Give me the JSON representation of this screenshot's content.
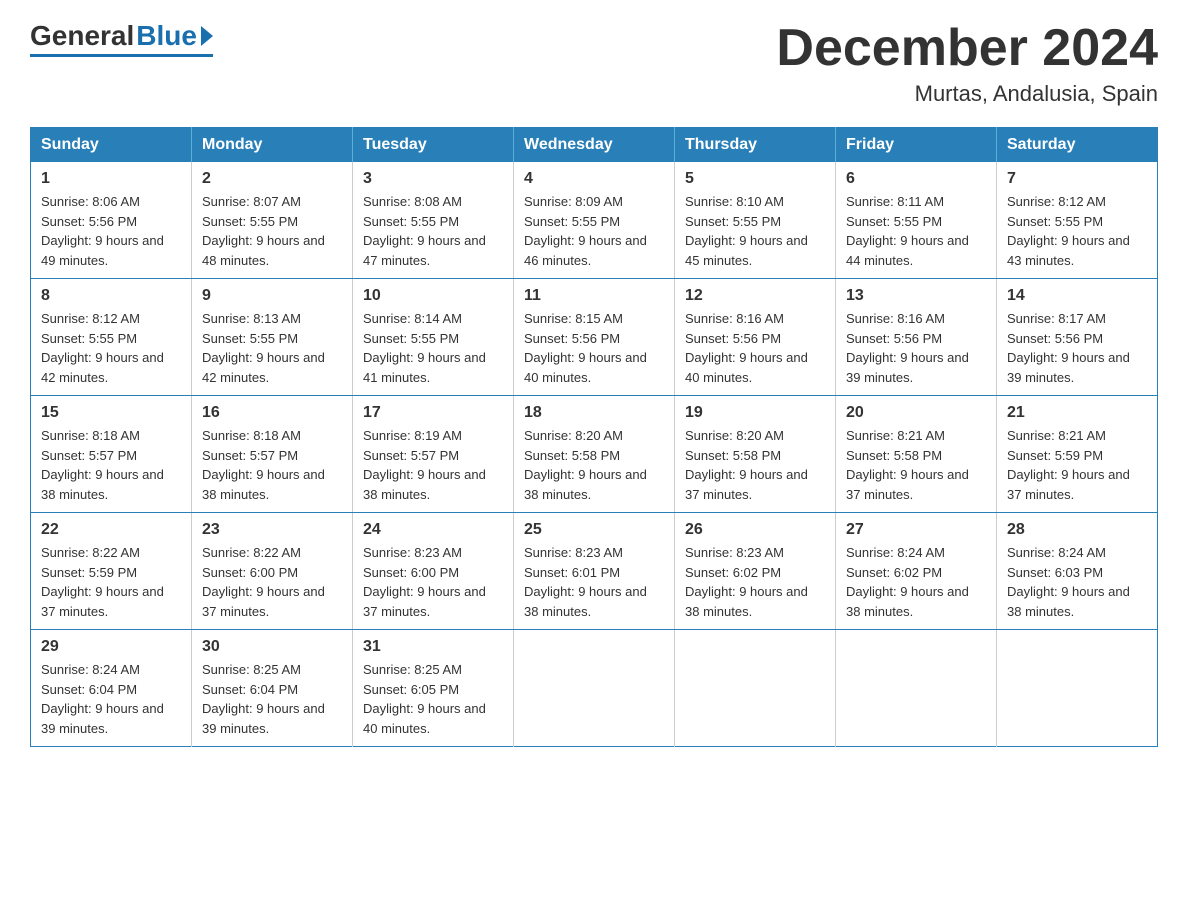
{
  "header": {
    "logo_general": "General",
    "logo_blue": "Blue",
    "month_title": "December 2024",
    "location": "Murtas, Andalusia, Spain"
  },
  "days_of_week": [
    "Sunday",
    "Monday",
    "Tuesday",
    "Wednesday",
    "Thursday",
    "Friday",
    "Saturday"
  ],
  "weeks": [
    [
      {
        "day": "1",
        "sunrise": "8:06 AM",
        "sunset": "5:56 PM",
        "daylight": "9 hours and 49 minutes."
      },
      {
        "day": "2",
        "sunrise": "8:07 AM",
        "sunset": "5:55 PM",
        "daylight": "9 hours and 48 minutes."
      },
      {
        "day": "3",
        "sunrise": "8:08 AM",
        "sunset": "5:55 PM",
        "daylight": "9 hours and 47 minutes."
      },
      {
        "day": "4",
        "sunrise": "8:09 AM",
        "sunset": "5:55 PM",
        "daylight": "9 hours and 46 minutes."
      },
      {
        "day": "5",
        "sunrise": "8:10 AM",
        "sunset": "5:55 PM",
        "daylight": "9 hours and 45 minutes."
      },
      {
        "day": "6",
        "sunrise": "8:11 AM",
        "sunset": "5:55 PM",
        "daylight": "9 hours and 44 minutes."
      },
      {
        "day": "7",
        "sunrise": "8:12 AM",
        "sunset": "5:55 PM",
        "daylight": "9 hours and 43 minutes."
      }
    ],
    [
      {
        "day": "8",
        "sunrise": "8:12 AM",
        "sunset": "5:55 PM",
        "daylight": "9 hours and 42 minutes."
      },
      {
        "day": "9",
        "sunrise": "8:13 AM",
        "sunset": "5:55 PM",
        "daylight": "9 hours and 42 minutes."
      },
      {
        "day": "10",
        "sunrise": "8:14 AM",
        "sunset": "5:55 PM",
        "daylight": "9 hours and 41 minutes."
      },
      {
        "day": "11",
        "sunrise": "8:15 AM",
        "sunset": "5:56 PM",
        "daylight": "9 hours and 40 minutes."
      },
      {
        "day": "12",
        "sunrise": "8:16 AM",
        "sunset": "5:56 PM",
        "daylight": "9 hours and 40 minutes."
      },
      {
        "day": "13",
        "sunrise": "8:16 AM",
        "sunset": "5:56 PM",
        "daylight": "9 hours and 39 minutes."
      },
      {
        "day": "14",
        "sunrise": "8:17 AM",
        "sunset": "5:56 PM",
        "daylight": "9 hours and 39 minutes."
      }
    ],
    [
      {
        "day": "15",
        "sunrise": "8:18 AM",
        "sunset": "5:57 PM",
        "daylight": "9 hours and 38 minutes."
      },
      {
        "day": "16",
        "sunrise": "8:18 AM",
        "sunset": "5:57 PM",
        "daylight": "9 hours and 38 minutes."
      },
      {
        "day": "17",
        "sunrise": "8:19 AM",
        "sunset": "5:57 PM",
        "daylight": "9 hours and 38 minutes."
      },
      {
        "day": "18",
        "sunrise": "8:20 AM",
        "sunset": "5:58 PM",
        "daylight": "9 hours and 38 minutes."
      },
      {
        "day": "19",
        "sunrise": "8:20 AM",
        "sunset": "5:58 PM",
        "daylight": "9 hours and 37 minutes."
      },
      {
        "day": "20",
        "sunrise": "8:21 AM",
        "sunset": "5:58 PM",
        "daylight": "9 hours and 37 minutes."
      },
      {
        "day": "21",
        "sunrise": "8:21 AM",
        "sunset": "5:59 PM",
        "daylight": "9 hours and 37 minutes."
      }
    ],
    [
      {
        "day": "22",
        "sunrise": "8:22 AM",
        "sunset": "5:59 PM",
        "daylight": "9 hours and 37 minutes."
      },
      {
        "day": "23",
        "sunrise": "8:22 AM",
        "sunset": "6:00 PM",
        "daylight": "9 hours and 37 minutes."
      },
      {
        "day": "24",
        "sunrise": "8:23 AM",
        "sunset": "6:00 PM",
        "daylight": "9 hours and 37 minutes."
      },
      {
        "day": "25",
        "sunrise": "8:23 AM",
        "sunset": "6:01 PM",
        "daylight": "9 hours and 38 minutes."
      },
      {
        "day": "26",
        "sunrise": "8:23 AM",
        "sunset": "6:02 PM",
        "daylight": "9 hours and 38 minutes."
      },
      {
        "day": "27",
        "sunrise": "8:24 AM",
        "sunset": "6:02 PM",
        "daylight": "9 hours and 38 minutes."
      },
      {
        "day": "28",
        "sunrise": "8:24 AM",
        "sunset": "6:03 PM",
        "daylight": "9 hours and 38 minutes."
      }
    ],
    [
      {
        "day": "29",
        "sunrise": "8:24 AM",
        "sunset": "6:04 PM",
        "daylight": "9 hours and 39 minutes."
      },
      {
        "day": "30",
        "sunrise": "8:25 AM",
        "sunset": "6:04 PM",
        "daylight": "9 hours and 39 minutes."
      },
      {
        "day": "31",
        "sunrise": "8:25 AM",
        "sunset": "6:05 PM",
        "daylight": "9 hours and 40 minutes."
      },
      null,
      null,
      null,
      null
    ]
  ]
}
